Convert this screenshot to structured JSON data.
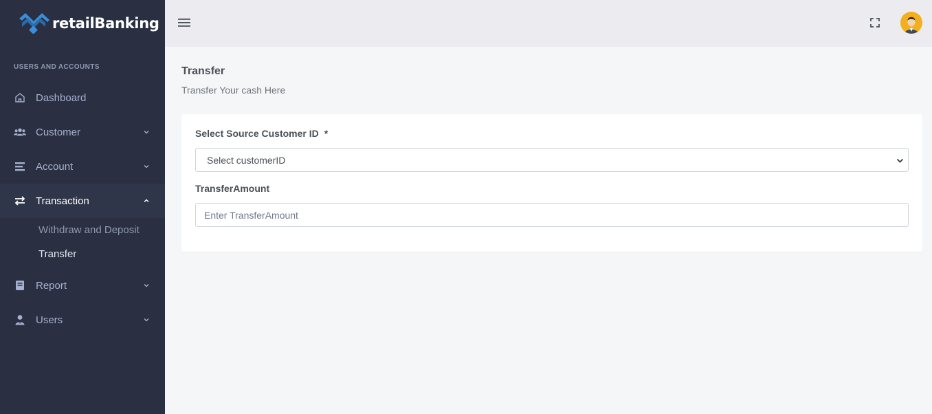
{
  "brand": {
    "name": "retailBanking"
  },
  "sidebar": {
    "section_title": "USERS AND ACCOUNTS",
    "items": [
      {
        "label": "Dashboard",
        "icon": "home-icon"
      },
      {
        "label": "Customer",
        "icon": "users-icon"
      },
      {
        "label": "Account",
        "icon": "list-icon"
      },
      {
        "label": "Transaction",
        "icon": "exchange-icon"
      },
      {
        "label": "Report",
        "icon": "book-icon"
      },
      {
        "label": "Users",
        "icon": "user-tie-icon"
      }
    ],
    "transaction_sub": [
      {
        "label": "Withdraw and Deposit"
      },
      {
        "label": "Transfer"
      }
    ]
  },
  "page": {
    "title": "Transfer",
    "subtitle": "Transfer Your cash Here"
  },
  "form": {
    "source_label": "Select Source Customer ID",
    "required_mark": "*",
    "source_select_value": "Select customerID",
    "amount_label": "TransferAmount",
    "amount_placeholder": "Enter TransferAmount"
  },
  "colors": {
    "sidebar_bg": "#2a3042",
    "topbar_bg": "#ececf0",
    "content_bg": "#f5f6f8",
    "logo_accent": "#3a8fd8"
  }
}
